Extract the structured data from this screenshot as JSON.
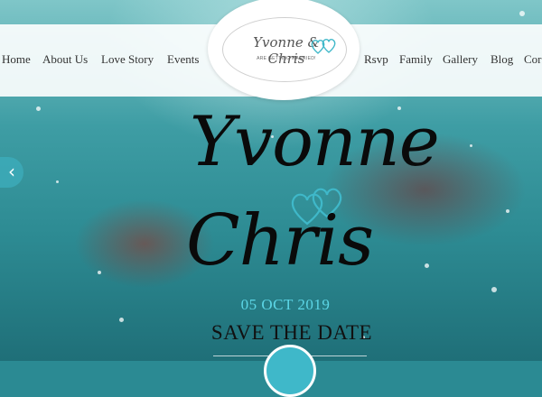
{
  "nav": {
    "left_items": [
      {
        "label": "Home"
      },
      {
        "label": "About Us"
      },
      {
        "label": "Love Story"
      },
      {
        "label": "Events"
      }
    ],
    "right_items": [
      {
        "label": "Rsvp"
      },
      {
        "label": "Family"
      },
      {
        "label": "Gallery"
      },
      {
        "label": "Blog"
      },
      {
        "label": "Cor"
      }
    ]
  },
  "logo": {
    "names": "Yvonne & Chris",
    "tagline": "ARE GETTING MARRIED!"
  },
  "hero": {
    "name_first": "Yvonne",
    "name_second": "Chris",
    "date": "05 OCT 2019",
    "headline": "SAVE THE DATE"
  },
  "slider": {
    "prev_icon": "chevron-left-icon",
    "prev_glyph": "‹"
  },
  "colors": {
    "accent": "#3fb8c9",
    "date_text": "#5cd6e6",
    "nav_bg": "#ffffff"
  }
}
